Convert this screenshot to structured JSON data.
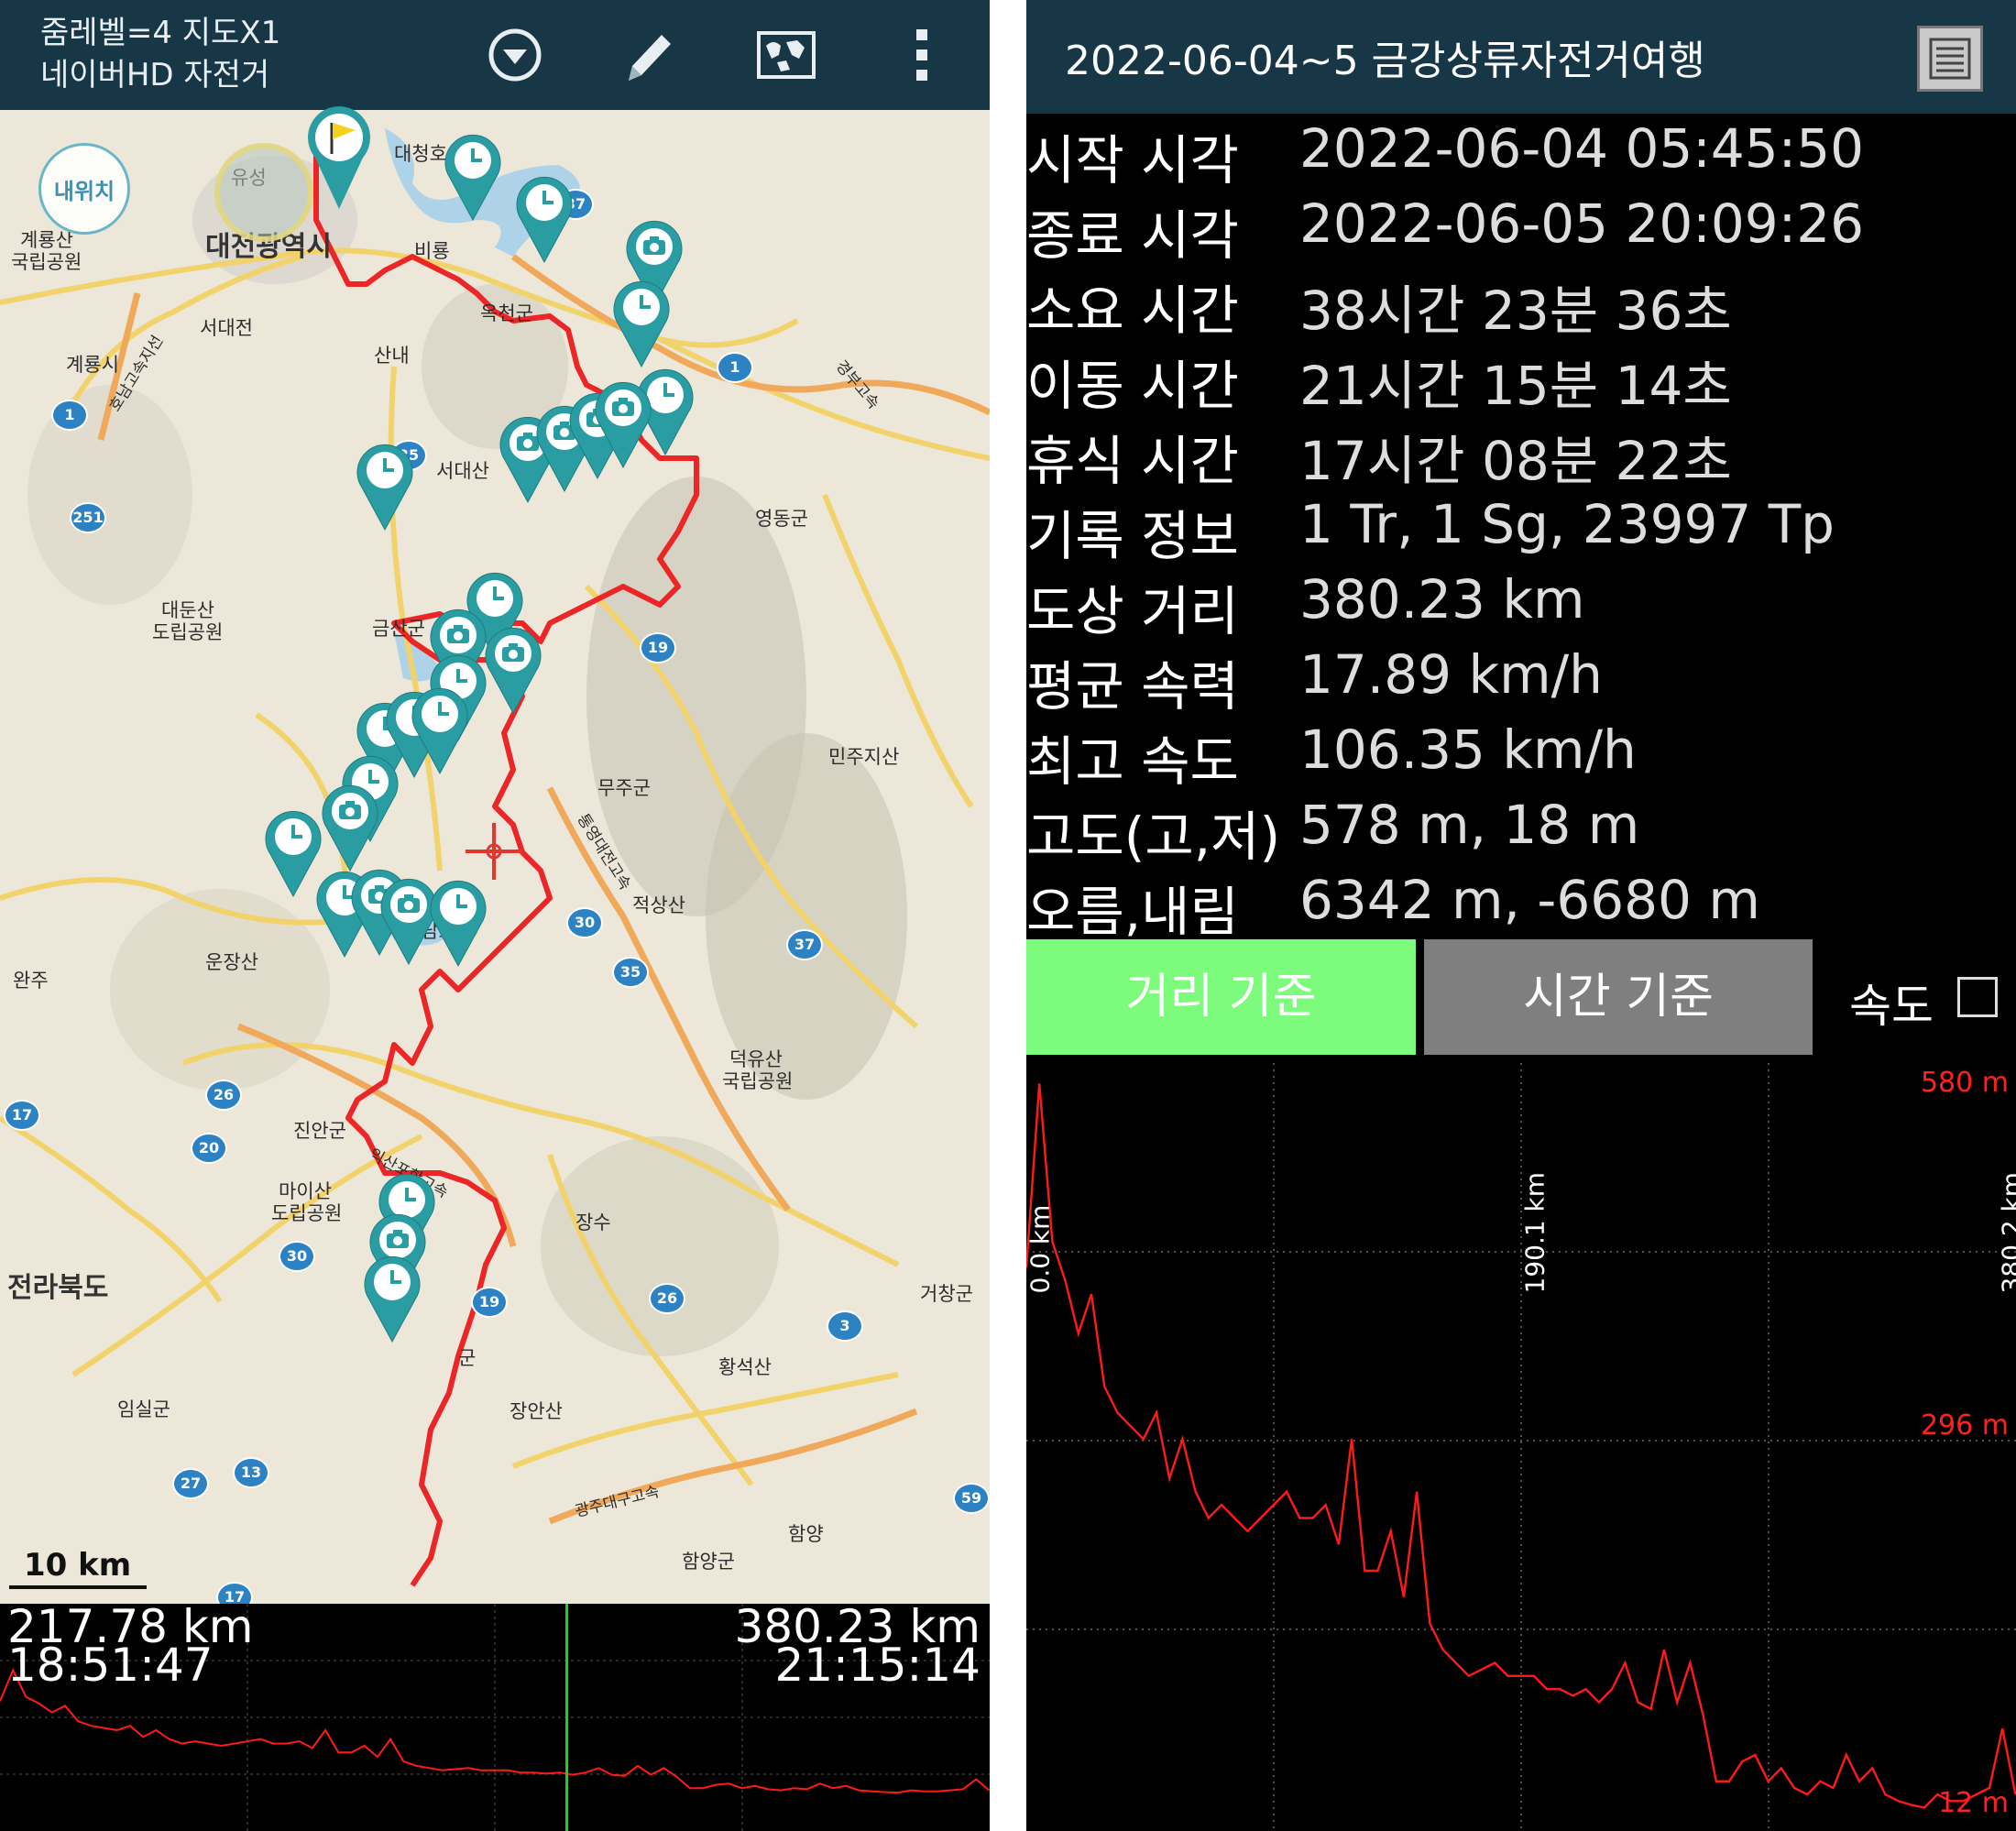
{
  "left_panel": {
    "header": {
      "line1": "줌레벨=4 지도X1",
      "line2": "네이버HD 자전거",
      "icons": [
        "dropdown-circle-icon",
        "pencil-icon",
        "world-map-icon",
        "more-vert-icon"
      ]
    },
    "map": {
      "my_location": "내위치",
      "scale_label": "10 km",
      "places": {
        "daejeon": "대전광역시",
        "jeonbuk": "전라북도",
        "daecheongho": "대청호",
        "yuseong": "유성",
        "biryong": "비룡",
        "seodaejeon": "서대전",
        "sannae": "산내",
        "gyeryongsi": "계룡시",
        "gyeryongsan_1": "계룡산",
        "gyeryongsan_2": "국립공원",
        "okcheon": "옥천군",
        "seodaesan": "서대산",
        "yeongdong": "영동군",
        "geumsan": "금산군",
        "daedunsan_1": "대둔산",
        "daedunsan_2": "도립공원",
        "minjujisan": "민주지산",
        "muju": "무주군",
        "jeoksangsan": "적상산",
        "yongdam": "용담호",
        "unjangsan": "운장산",
        "wanju": "완주",
        "deogyusan_1": "덕유산",
        "deogyusan_2": "국립공원",
        "jinan": "진안군",
        "maisan_1": "마이산",
        "maisan_2": "도립공원",
        "jangsu": "장수",
        "geochang": "거창군",
        "jangsugun": "군",
        "hwangseoksan": "황석산",
        "imsil": "임실군",
        "janganasan": "장안산",
        "hamyang": "함양",
        "hamyanggun": "함양군",
        "gyeongbu": "경부고속",
        "tongyeong": "통영대전고속",
        "iksan": "익산포항고속",
        "gwangju": "광주대구고속",
        "honam": "호남고속지선"
      },
      "route_shields": [
        "37",
        "1",
        "35",
        "251",
        "19",
        "30",
        "35",
        "37",
        "26",
        "20",
        "17",
        "30",
        "19",
        "26",
        "3",
        "27",
        "13",
        "59",
        "17",
        "1"
      ]
    },
    "mini_chart": {
      "left_distance": "217.78 km",
      "left_time": "18:51:47",
      "right_distance": "380.23 km",
      "right_time": "21:15:14"
    }
  },
  "right_panel": {
    "title": "2022-06-04~5 금강상류자전거여행",
    "menu_icon": "menu-list-icon",
    "stats": [
      {
        "label": "시작 시각",
        "value": "2022-06-04 05:45:50"
      },
      {
        "label": "종료 시각",
        "value": "2022-06-05 20:09:26"
      },
      {
        "label": "소요 시간",
        "value": "38시간 23분 36초"
      },
      {
        "label": "이동 시간",
        "value": "21시간 15분 14초"
      },
      {
        "label": "휴식 시간",
        "value": "17시간 08분 22초"
      },
      {
        "label": "기록 정보",
        "value": "1 Tr, 1 Sg, 23997 Tp"
      },
      {
        "label": "도상 거리",
        "value": "380.23 km"
      },
      {
        "label": "평균 속력",
        "value": "17.89 km/h"
      },
      {
        "label": "최고 속도",
        "value": "106.35 km/h"
      },
      {
        "label": "고도(고,저)",
        "value": "578 m, 18 m"
      },
      {
        "label": "오름,내림",
        "value": "6342 m, -6680 m"
      }
    ],
    "toggle": {
      "distance_label": "거리 기준",
      "time_label": "시간 기준",
      "speed_label": "속도",
      "distance_color": "#7dfb7d",
      "time_color": "#7f7f7f"
    },
    "elevation_chart": {
      "y_top_label": "580 m",
      "y_mid_label": "296 m",
      "y_bottom_label": "12 m",
      "x_start_label": "0.0 km",
      "x_mid_label": "190.1 km",
      "x_end_label": "380.2 km",
      "line_color": "#ff1a1a"
    }
  },
  "chart_data": {
    "type": "line",
    "title": "",
    "xlabel": "",
    "ylabel": "",
    "x_unit": "km",
    "y_unit": "m",
    "xlim": [
      0,
      380.2
    ],
    "ylim": [
      12,
      580
    ],
    "x": [
      0,
      5,
      10,
      15,
      20,
      25,
      30,
      35,
      40,
      45,
      50,
      55,
      60,
      65,
      70,
      75,
      80,
      85,
      90,
      95,
      100,
      105,
      110,
      115,
      120,
      125,
      130,
      135,
      140,
      145,
      150,
      155,
      160,
      165,
      170,
      175,
      180,
      185,
      190,
      195,
      200,
      205,
      210,
      215,
      220,
      225,
      230,
      235,
      240,
      245,
      250,
      255,
      260,
      265,
      270,
      275,
      280,
      285,
      290,
      295,
      300,
      305,
      310,
      315,
      320,
      325,
      330,
      335,
      340,
      345,
      350,
      355,
      360,
      365,
      370,
      375,
      380
    ],
    "series": [
      {
        "values": [
          430,
          570,
          450,
          420,
          380,
          410,
          340,
          320,
          310,
          300,
          320,
          270,
          300,
          260,
          240,
          250,
          240,
          230,
          240,
          250,
          260,
          240,
          240,
          250,
          220,
          300,
          200,
          200,
          230,
          180,
          260,
          160,
          140,
          130,
          120,
          125,
          130,
          120,
          120,
          120,
          110,
          110,
          105,
          110,
          100,
          110,
          130,
          100,
          95,
          140,
          100,
          130,
          90,
          40,
          40,
          55,
          60,
          40,
          50,
          35,
          30,
          40,
          35,
          60,
          40,
          50,
          30,
          25,
          22,
          20,
          30,
          25,
          25,
          30,
          35,
          80,
          30
        ]
      }
    ],
    "mini_chart_marker_km": 217.78
  }
}
